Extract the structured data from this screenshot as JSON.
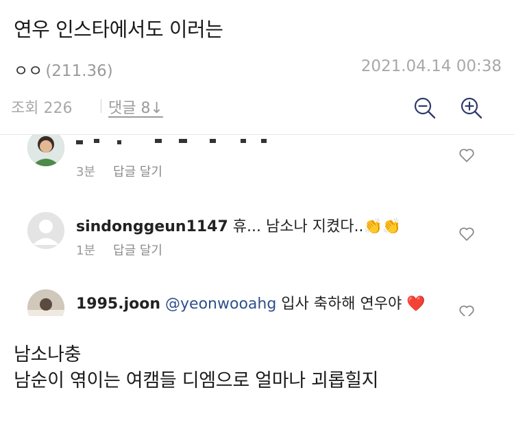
{
  "post": {
    "title": "연우 인스타에서도 이러는",
    "author": "ㅇㅇ",
    "author_ip": "(211.36)",
    "date": "2021.04.14 00:38",
    "views": "조회 226",
    "comments_link": "댓글 8↓"
  },
  "embedded_comments": [
    {
      "time": "3분",
      "reply": "답글 달기"
    },
    {
      "username": "sindonggeun1147",
      "text": "휴... 남소나 지켰다..",
      "emoji": "👏👏",
      "time": "1분",
      "reply": "답글 달기"
    },
    {
      "username": "1995.joon",
      "mention": "@yeonwooahg",
      "text": "입사 축하해 연우야",
      "emoji": "❤️"
    }
  ],
  "body": {
    "line1": "남소나충",
    "line2": "남순이 엮이는 여캠들 디엠으로 얼마나 괴롭힐지"
  },
  "colors": {
    "icon": "#2d3a6b",
    "muted": "#a8a8a8",
    "mention": "#2f4f8a"
  }
}
